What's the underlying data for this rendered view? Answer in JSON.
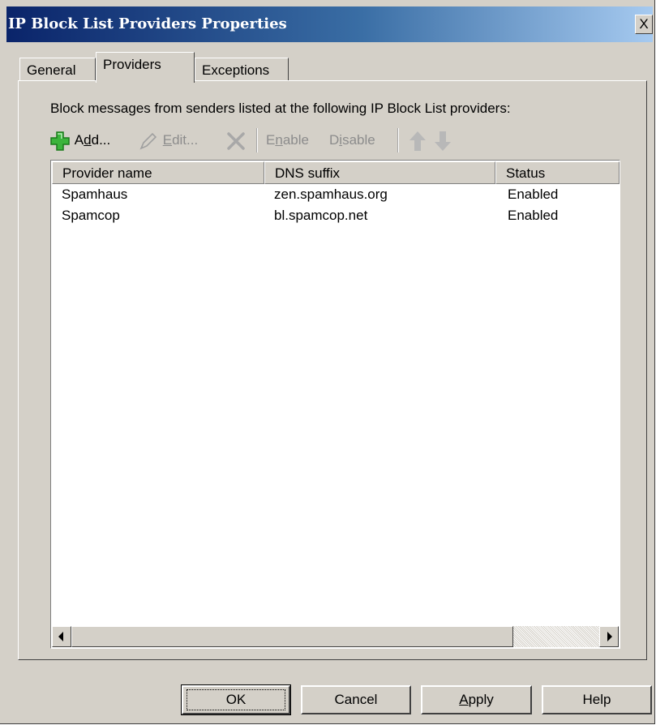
{
  "window": {
    "title": "IP Block List Providers Properties",
    "close_glyph": "X"
  },
  "tabs": [
    {
      "label": "General"
    },
    {
      "label": "Providers",
      "selected": true
    },
    {
      "label": "Exceptions"
    }
  ],
  "instruction": "Block messages from senders listed at the following IP Block List providers:",
  "toolbar": {
    "add": {
      "label_prefix": "A",
      "label_mnemonic": "d",
      "label_suffix": "d...",
      "icon": "add-plus-icon",
      "enabled": true
    },
    "edit": {
      "label_mnemonic": "E",
      "label_suffix": "dit...",
      "icon": "pencil-icon",
      "enabled": false
    },
    "remove": {
      "icon": "delete-x-icon",
      "enabled": false
    },
    "enable": {
      "label_prefix": "E",
      "label_mnemonic": "n",
      "label_suffix": "able",
      "enabled": false
    },
    "disable": {
      "label_prefix": "D",
      "label_mnemonic": "i",
      "label_suffix": "sable",
      "enabled": false
    },
    "move_up": {
      "icon": "arrow-up-icon",
      "enabled": false
    },
    "move_down": {
      "icon": "arrow-down-icon",
      "enabled": false
    }
  },
  "table": {
    "columns": [
      "Provider name",
      "DNS suffix",
      "Status"
    ],
    "rows": [
      {
        "name": "Spamhaus",
        "dns": "zen.spamhaus.org",
        "status": "Enabled"
      },
      {
        "name": "Spamcop",
        "dns": "bl.spamcop.net",
        "status": "Enabled"
      }
    ]
  },
  "scrollbar": {
    "left_arrow": "left-arrow-icon",
    "right_arrow": "right-arrow-icon"
  },
  "buttons": {
    "ok": "OK",
    "cancel": "Cancel",
    "apply_mnemonic": "A",
    "apply_suffix": "pply",
    "help": "Help"
  },
  "colors": {
    "title_start": "#0a246a",
    "title_end": "#a6caf0",
    "face": "#d4d0c8",
    "disabled_text": "#8c8c8c",
    "add_icon": "#3cb43c"
  }
}
